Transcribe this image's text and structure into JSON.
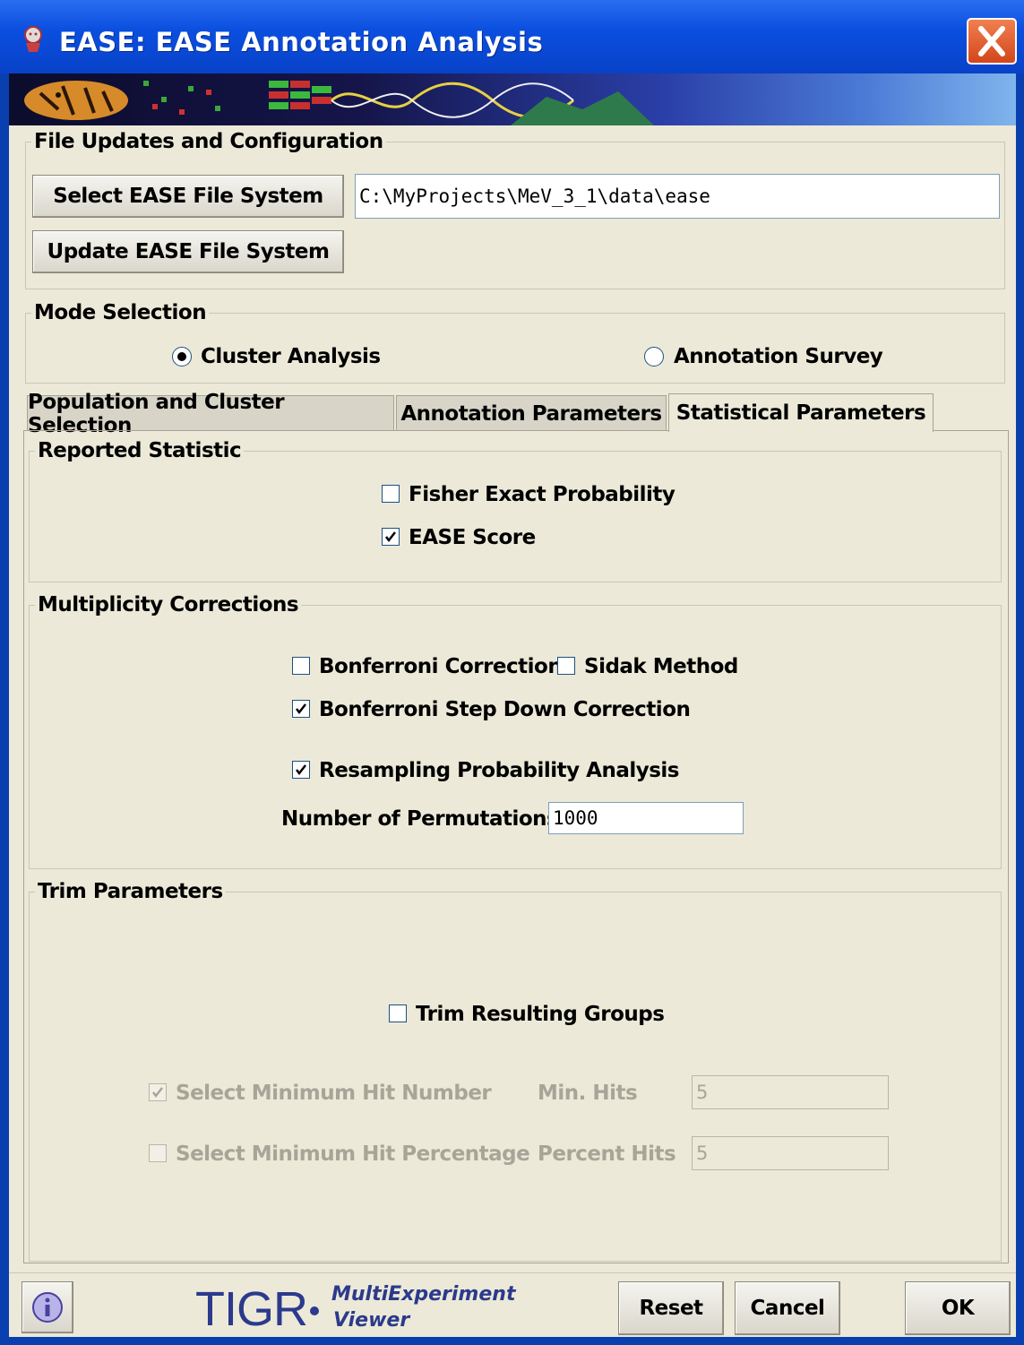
{
  "window": {
    "title": "EASE: EASE Annotation Analysis",
    "icons": {
      "app": "tigr-app-icon",
      "close": "close-icon"
    }
  },
  "file_updates": {
    "legend": "File Updates and Configuration",
    "select_button": "Select EASE File System",
    "update_button": "Update EASE File System",
    "path_value": "C:\\MyProjects\\MeV_3_1\\data\\ease"
  },
  "mode": {
    "legend": "Mode Selection",
    "cluster_label": "Cluster Analysis",
    "survey_label": "Annotation Survey",
    "selected": "Cluster Analysis"
  },
  "tabs": [
    {
      "label": "Population and Cluster Selection",
      "active": false
    },
    {
      "label": "Annotation Parameters",
      "active": false
    },
    {
      "label": "Statistical Parameters",
      "active": true
    }
  ],
  "reported_statistic": {
    "legend": "Reported Statistic",
    "fisher_label": "Fisher Exact Probability",
    "fisher_checked": false,
    "ease_label": "EASE Score",
    "ease_checked": true
  },
  "multiplicity": {
    "legend": "Multiplicity Corrections",
    "bonferroni_label": "Bonferroni Correction",
    "bonferroni_checked": false,
    "sidak_label": "Sidak Method",
    "sidak_checked": false,
    "stepdown_label": "Bonferroni Step Down Correction",
    "stepdown_checked": true,
    "resampling_label": "Resampling Probability Analysis",
    "resampling_checked": true,
    "permutations_label": "Number of Permutations",
    "permutations_value": "1000"
  },
  "trim": {
    "legend": "Trim Parameters",
    "trim_label": "Trim Resulting Groups",
    "trim_checked": false,
    "min_hit_label": "Select Minimum Hit Number",
    "min_hit_checked": true,
    "min_hits_label": "Min. Hits",
    "min_hits_value": "5",
    "min_pct_label": "Select Minimum Hit Percentage",
    "min_pct_checked": false,
    "percent_hits_label": "Percent Hits",
    "percent_hits_value": "5"
  },
  "footer": {
    "logo_tigr": "TIGR",
    "logo_multi": "MultiExperiment",
    "logo_viewer": "Viewer",
    "reset": "Reset",
    "cancel": "Cancel",
    "ok": "OK",
    "info_icon": "info-icon"
  }
}
